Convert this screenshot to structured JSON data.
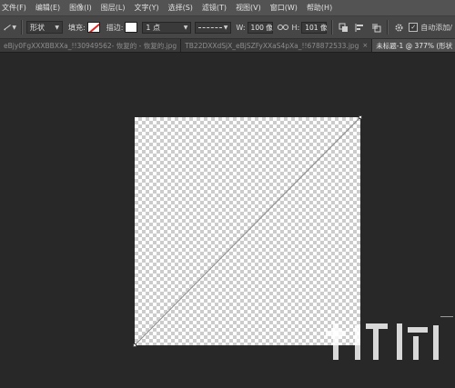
{
  "menubar": {
    "items": [
      "文件(F)",
      "编辑(E)",
      "图像(I)",
      "图层(L)",
      "文字(Y)",
      "选择(S)",
      "滤镜(T)",
      "视图(V)",
      "窗口(W)",
      "帮助(H)"
    ]
  },
  "options": {
    "shape_mode": "形状",
    "fill_label": "填充:",
    "stroke_label": "描边:",
    "stroke_width": "1 点",
    "w_label": "W:",
    "w_value": "100 像",
    "h_label": "H:",
    "h_value": "101 像",
    "auto_add_label": "自动添加/",
    "fill_color": "none",
    "stroke_color": "#ffffff"
  },
  "tabs": [
    {
      "label": "eBjy0FgXXXBBXXa_!!30949562- 恢复的 - 恢复的.jpg",
      "active": false
    },
    {
      "label": "TB22DXXdSjX_eBjSZFyXXaS4pXa_!!678872533.jpg",
      "active": false
    },
    {
      "label": "未标题-1 @ 377% (形状 1, RGB",
      "active": true
    }
  ],
  "icons": {
    "link": "link-icon",
    "gear": "gear-icon",
    "path_ops": "path-operations-icon",
    "path_align": "path-alignment-icon",
    "path_arrange": "path-arrangement-icon"
  }
}
